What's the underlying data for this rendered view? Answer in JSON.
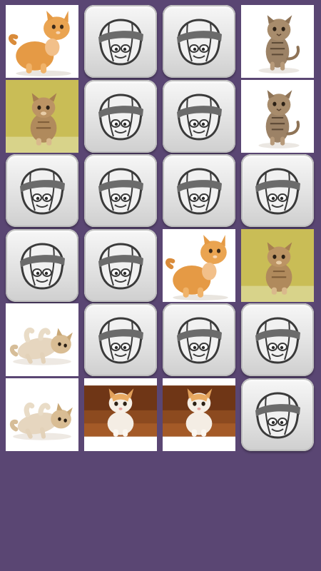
{
  "game": {
    "type": "memory-match",
    "columns": 4,
    "rows": 6
  },
  "colors": {
    "background": "#5a4673",
    "tile_back": "#e6e6e6",
    "mascot_stroke": "#3a3a3a"
  },
  "tiles": [
    {
      "state": "face-up",
      "image": "kitten-orange-sitting-icon"
    },
    {
      "state": "face-down",
      "image": "card-back-mascot-icon"
    },
    {
      "state": "face-down",
      "image": "card-back-mascot-icon"
    },
    {
      "state": "face-up",
      "image": "kitten-tabby-standing-icon"
    },
    {
      "state": "face-up",
      "image": "kitten-tabby-yellow-bg-icon"
    },
    {
      "state": "face-down",
      "image": "card-back-mascot-icon"
    },
    {
      "state": "face-down",
      "image": "card-back-mascot-icon"
    },
    {
      "state": "face-up",
      "image": "kitten-tabby-standing-icon"
    },
    {
      "state": "face-down",
      "image": "card-back-mascot-icon"
    },
    {
      "state": "face-down",
      "image": "card-back-mascot-icon"
    },
    {
      "state": "face-down",
      "image": "card-back-mascot-icon"
    },
    {
      "state": "face-down",
      "image": "card-back-mascot-icon"
    },
    {
      "state": "face-down",
      "image": "card-back-mascot-icon"
    },
    {
      "state": "face-down",
      "image": "card-back-mascot-icon"
    },
    {
      "state": "face-up",
      "image": "kitten-orange-sitting-icon"
    },
    {
      "state": "face-up",
      "image": "kitten-tabby-yellow-bg-icon"
    },
    {
      "state": "face-up",
      "image": "kitten-lying-playful-icon"
    },
    {
      "state": "face-down",
      "image": "card-back-mascot-icon"
    },
    {
      "state": "face-down",
      "image": "card-back-mascot-icon"
    },
    {
      "state": "face-down",
      "image": "card-back-mascot-icon"
    },
    {
      "state": "face-up",
      "image": "kitten-lying-playful-icon"
    },
    {
      "state": "face-up",
      "image": "kitten-orange-white-floor-icon"
    },
    {
      "state": "face-up",
      "image": "kitten-orange-white-floor-icon"
    },
    {
      "state": "face-down",
      "image": "card-back-mascot-icon"
    }
  ]
}
